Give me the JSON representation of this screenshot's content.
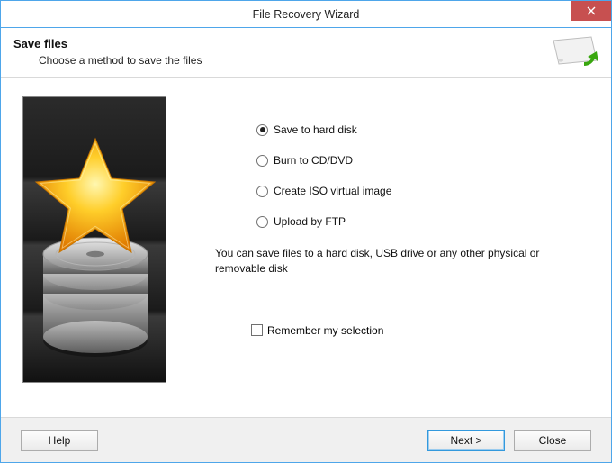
{
  "window": {
    "title": "File Recovery Wizard"
  },
  "header": {
    "title": "Save files",
    "subtitle": "Choose a method to save the files"
  },
  "options": {
    "selectedIndex": 0,
    "items": [
      {
        "label": "Save to hard disk"
      },
      {
        "label": "Burn to CD/DVD"
      },
      {
        "label": "Create ISO virtual image"
      },
      {
        "label": "Upload by FTP"
      }
    ],
    "hint": "You can save files to a hard disk, USB drive or any other physical or removable disk"
  },
  "remember": {
    "checked": false,
    "label": "Remember my selection"
  },
  "buttons": {
    "help": "Help",
    "next": "Next  >",
    "close": "Close"
  }
}
